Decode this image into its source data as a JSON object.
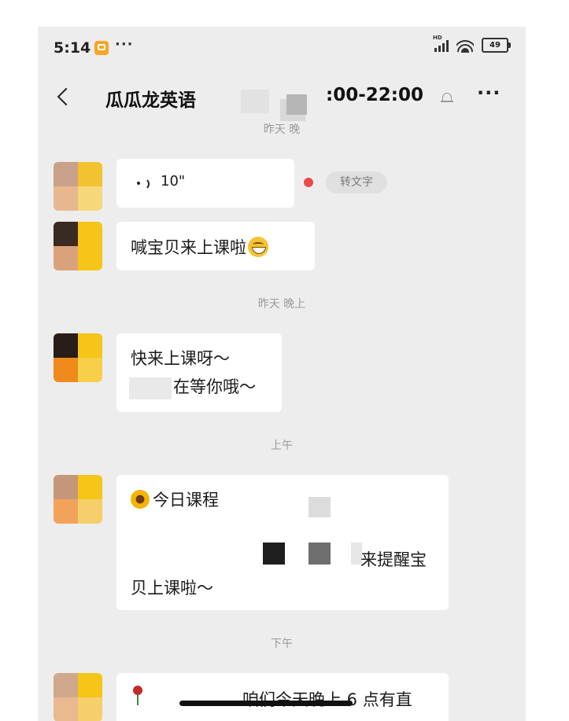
{
  "status_bar": {
    "time": "5:14",
    "more": "···",
    "signal_label": "HD",
    "battery": "49"
  },
  "header": {
    "title": "瓜瓜龙英语",
    "hours": ":00-22:00",
    "more": "···"
  },
  "separators": {
    "top_partial": "昨天 晚",
    "yesterday_evening": "昨天 晚上",
    "morning": "上午",
    "afternoon": "下午"
  },
  "messages": [
    {
      "type": "voice",
      "duration": "10\"",
      "action": "转文字"
    },
    {
      "type": "text",
      "text": "喊宝贝来上课啦"
    },
    {
      "type": "text",
      "line1": "快来上课呀～",
      "line2": "在等你哦～"
    },
    {
      "type": "text",
      "title": "今日课程",
      "line2": "来提醒宝",
      "line3": "贝上课啦～"
    },
    {
      "type": "text",
      "partial": "咱们今天晚上 6 点有直"
    }
  ],
  "colors": {
    "chat_background": "#ededed",
    "bubble": "#ffffff",
    "unread_dot": "#ea4b4b",
    "avatar_accent": "#f5c518"
  }
}
